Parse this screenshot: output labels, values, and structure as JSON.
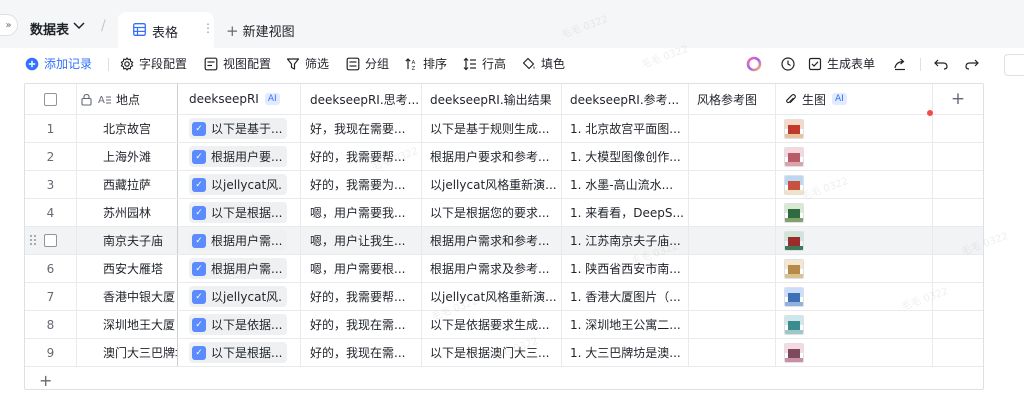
{
  "nav": {
    "table_name": "数据表",
    "active_tab": "表格",
    "new_view": "新建视图"
  },
  "toolbar": {
    "add_record": "添加记录",
    "field_config": "字段配置",
    "view_config": "视图配置",
    "filter": "筛选",
    "group": "分组",
    "sort": "排序",
    "row_height": "行高",
    "fill": "填色",
    "generate_form": "生成表单"
  },
  "columns": {
    "place": "地点",
    "deekseep": "deekseepRI",
    "think": "deekseepRI.思考...",
    "output": "deekseepRI.输出结果",
    "reference": "deekseepRI.参考...",
    "style_ref": "风格参考图",
    "generated": "生图",
    "ai_badge": "AI"
  },
  "rows": [
    {
      "num": "1",
      "place": "北京故宫",
      "chip": "以下是基于...",
      "think": "好，我现在需要...",
      "output": "以下是基于规则生成...",
      "ref": "1. 北京故宫平面图...",
      "thumb": "palace-red"
    },
    {
      "num": "2",
      "place": "上海外滩",
      "chip": "根据用户要...",
      "think": "好的，我需要帮...",
      "output": "根据用户要求和参考...",
      "ref": "1. 大模型图像创作...",
      "thumb": "bund-pink"
    },
    {
      "num": "3",
      "place": "西藏拉萨",
      "chip": "以jellycat风...",
      "think": "好的，我需要为...",
      "output": "以jellycat风格重新演...",
      "ref": "1. 水墨-高山流水...",
      "thumb": "potala-sky"
    },
    {
      "num": "4",
      "place": "苏州园林",
      "chip": "以下是根据...",
      "think": "嗯，用户需要我...",
      "output": "以下是根据您的要求...",
      "ref": "1. 来看看，DeepS...",
      "thumb": "garden-green"
    },
    {
      "num": "5",
      "place": "南京夫子庙",
      "chip": "根据用户需...",
      "think": "嗯，用户让我生...",
      "output": "根据用户需求和参考...",
      "ref": "1. 江苏南京夫子庙...",
      "thumb": "temple-green"
    },
    {
      "num": "6",
      "place": "西安大雁塔",
      "chip": "根据用户需...",
      "think": "嗯，用户需要根...",
      "output": "根据用户需求及参考...",
      "ref": "1. 陕西省西安市南...",
      "thumb": "pagoda-cream"
    },
    {
      "num": "7",
      "place": "香港中银大厦",
      "chip": "以jellycat风...",
      "think": "好的，我需要帮...",
      "output": "以jellycat风格重新演...",
      "ref": "1. 香港大厦图片（...",
      "thumb": "tower-blue"
    },
    {
      "num": "8",
      "place": "深圳地王大厦",
      "chip": "以下是依据...",
      "think": "好的，我现在需...",
      "output": "以下是依据要求生成...",
      "ref": "1. 深圳地王公寓二...",
      "thumb": "tower-teal"
    },
    {
      "num": "9",
      "place": "澳门大三巴牌坊",
      "chip": "以下是根据...",
      "think": "好的，我现在需...",
      "output": "以下是根据澳门大三...",
      "ref": "1. 大三巴牌坊是澳...",
      "thumb": "ruins-pink"
    }
  ],
  "thumb_colors": {
    "palace-red": [
      "#f4d9c6",
      "#c0392b",
      "#e9c39b"
    ],
    "bund-pink": [
      "#f7d7dd",
      "#b85c6a",
      "#d9a4ae"
    ],
    "potala-sky": [
      "#bcd7f2",
      "#c7523f",
      "#efe3c8"
    ],
    "garden-green": [
      "#d8ead2",
      "#2e6b3e",
      "#7fa36b"
    ],
    "temple-green": [
      "#cfe5d8",
      "#9c2b2b",
      "#3b7a57"
    ],
    "pagoda-cream": [
      "#f3e8cf",
      "#b88a4a",
      "#d9c28f"
    ],
    "tower-blue": [
      "#c9defa",
      "#3f6fb5",
      "#8fb1e0"
    ],
    "tower-teal": [
      "#cbe9ea",
      "#3c8c8f",
      "#9cc8c9"
    ],
    "ruins-pink": [
      "#f6d9e2",
      "#7d4a5d",
      "#c98fa5"
    ]
  },
  "colors": {
    "accent": "#3370ff",
    "border": "#dee0e3",
    "highlight_row": "#f2f3f5"
  },
  "watermark": "毛毛 0322"
}
